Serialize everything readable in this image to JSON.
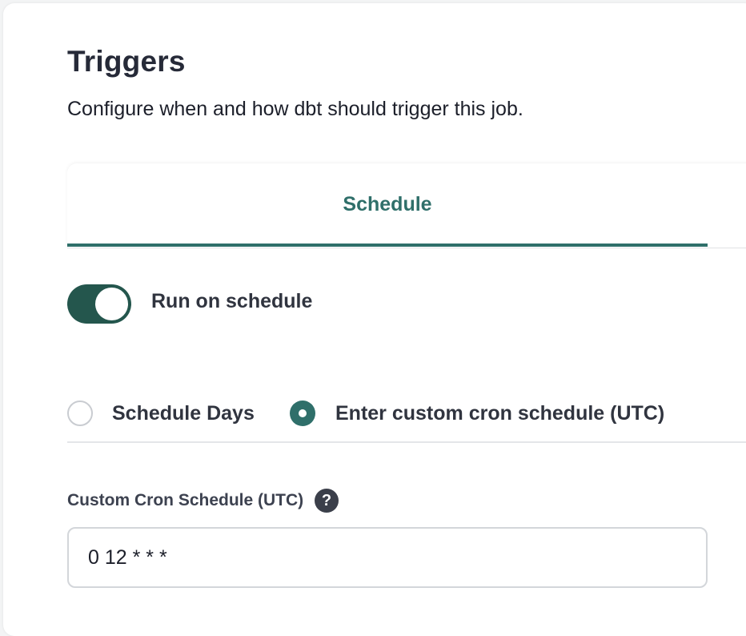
{
  "section": {
    "title": "Triggers",
    "subtitle": "Configure when and how dbt should trigger this job."
  },
  "tabs": [
    {
      "label": "Schedule",
      "active": true
    }
  ],
  "schedule_toggle": {
    "label": "Run on schedule",
    "on": true
  },
  "schedule_mode": {
    "options": [
      {
        "label": "Schedule Days",
        "selected": false
      },
      {
        "label": "Enter custom cron schedule (UTC)",
        "selected": true
      }
    ]
  },
  "cron_field": {
    "label": "Custom Cron Schedule (UTC)",
    "help_icon": "question-circle-icon",
    "value": "0 12 * * *"
  },
  "colors": {
    "accent": "#2f6f6a",
    "toggle_on": "#24564d"
  }
}
